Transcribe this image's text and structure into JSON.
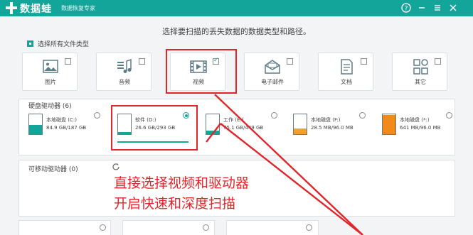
{
  "titlebar": {
    "app_name": "数据蛙",
    "app_subtitle": "数据恢复专家",
    "bg_color": "#13a49a",
    "buttons": [
      "help-icon",
      "minimize-icon",
      "menu-icon",
      "close-icon"
    ]
  },
  "instruction": "选择要扫描的丢失数据的数据类型和路径。",
  "select_all_label": "选择所有文件类型",
  "file_types": [
    {
      "label": "图片",
      "icon": "image-icon",
      "checked": false
    },
    {
      "label": "音频",
      "icon": "audio-icon",
      "checked": false
    },
    {
      "label": "视频",
      "icon": "video-icon",
      "checked": true
    },
    {
      "label": "电子邮件",
      "icon": "email-icon",
      "checked": false
    },
    {
      "label": "文档",
      "icon": "document-icon",
      "checked": false
    },
    {
      "label": "其它",
      "icon": "other-icon",
      "checked": false
    }
  ],
  "hard_drives": {
    "title": "硬盘驱动器 (6)",
    "items": [
      {
        "name": "本地磁盘 (C:)",
        "size": "84.9 GB/187 GB",
        "fill": 0.45,
        "color": "#13a49a",
        "selected": false
      },
      {
        "name": "软件 (D:)",
        "size": "26.6 GB/293 GB",
        "fill": 0.09,
        "color": "#13a49a",
        "selected": true
      },
      {
        "name": "工作 (E:)",
        "size": "75.1 GB/449 GB",
        "fill": 0.17,
        "color": "#13a49a",
        "selected": false
      },
      {
        "name": "本地磁盘 (F:)",
        "size": "28.5 MB/96.0 MB",
        "fill": 0.3,
        "color": "#f5a02a",
        "selected": false
      },
      {
        "name": "本地磁盘 (*:)",
        "size": "641 MB/96.0 MB",
        "fill": 0.95,
        "color": "#f18a1c",
        "selected": false
      }
    ]
  },
  "removable_drives": {
    "title": "可移动驱动器 (0)"
  },
  "annotation": {
    "line1": "直接选择视频和驱动器",
    "line2": "开启快速和深度扫描",
    "color": "#e0262b"
  }
}
